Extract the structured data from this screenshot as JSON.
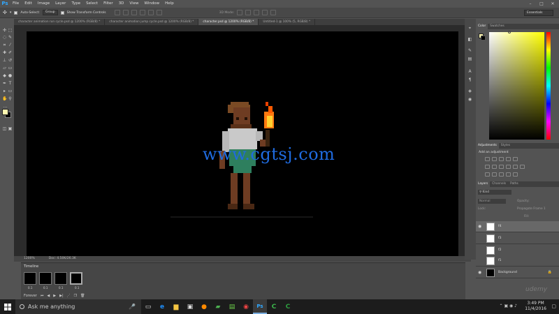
{
  "app": {
    "logo": "Ps"
  },
  "menu": [
    "File",
    "Edit",
    "Image",
    "Layer",
    "Type",
    "Select",
    "Filter",
    "3D",
    "View",
    "Window",
    "Help"
  ],
  "options": {
    "auto_select": "Auto-Select:",
    "group": "Group",
    "transform": "Show Transform Controls",
    "mode3d": "3D Mode:",
    "workspace": "Essentials"
  },
  "tabs": [
    {
      "label": "character animation run cycle.psd @ 1200% (RGB/8) *",
      "active": false
    },
    {
      "label": "character animation jump cycle.psd @ 1200% (RGB/8) *",
      "active": false
    },
    {
      "label": "character.psd @ 1200% (RGB/8) *",
      "active": true
    },
    {
      "label": "Untitled-1 @ 100% (5, RGB/8) *",
      "active": false
    }
  ],
  "status": {
    "zoom": "1200%",
    "doc": "Doc: 4.50K/26.3K"
  },
  "watermark": "www.cgtsj.com",
  "timeline": {
    "title": "Timeline",
    "frames": [
      {
        "n": "1",
        "d": "0.1"
      },
      {
        "n": "2",
        "d": "0.1"
      },
      {
        "n": "3",
        "d": "0.1"
      },
      {
        "n": "4",
        "d": "0.1"
      }
    ],
    "loop": "Forever"
  },
  "color_panel": {
    "tabs": [
      "Color",
      "Swatches"
    ],
    "fg": "#fff7b0",
    "bg": "#000000"
  },
  "adjust_panel": {
    "tabs": [
      "Adjustments",
      "Styles"
    ],
    "add": "Add an adjustment"
  },
  "layers_panel": {
    "tabs": [
      "Layers",
      "Channels",
      "Paths"
    ],
    "kind": "Kind",
    "blend": "Normal",
    "opacity": "Opacity:",
    "lock": "Lock:",
    "fill": "Fill:",
    "propagate": "Propagate Frame 1",
    "layers": [
      {
        "name": "f4",
        "selected": true,
        "visible": true
      },
      {
        "name": "f3",
        "selected": false,
        "visible": false
      },
      {
        "name": "f2",
        "selected": false,
        "visible": false
      },
      {
        "name": "f1",
        "selected": false,
        "visible": false
      },
      {
        "name": "Background",
        "selected": false,
        "visible": true,
        "black": true
      }
    ]
  },
  "taskbar": {
    "search": "Ask me anything",
    "time": "3:49 PM",
    "date": "11/4/2016"
  },
  "brand": "udemy"
}
